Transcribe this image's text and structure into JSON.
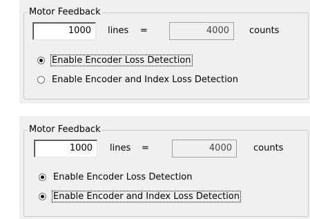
{
  "panels": [
    {
      "group_title": "Motor Feedback",
      "lines_value": "1000",
      "lines_label": "lines",
      "equals": "=",
      "counts_value": "4000",
      "counts_label": "counts",
      "options": [
        {
          "label": "Enable Encoder Loss Detection",
          "selected": true,
          "focused": true
        },
        {
          "label": "Enable Encoder and Index Loss Detection",
          "selected": false,
          "focused": false
        }
      ]
    },
    {
      "group_title": "Motor Feedback",
      "lines_value": "1000",
      "lines_label": "lines",
      "equals": "=",
      "counts_value": "4000",
      "counts_label": "counts",
      "options": [
        {
          "label": "Enable Encoder Loss Detection",
          "selected": true,
          "focused": false
        },
        {
          "label": "Enable Encoder and Index Loss Detection",
          "selected": true,
          "focused": true
        }
      ]
    }
  ]
}
